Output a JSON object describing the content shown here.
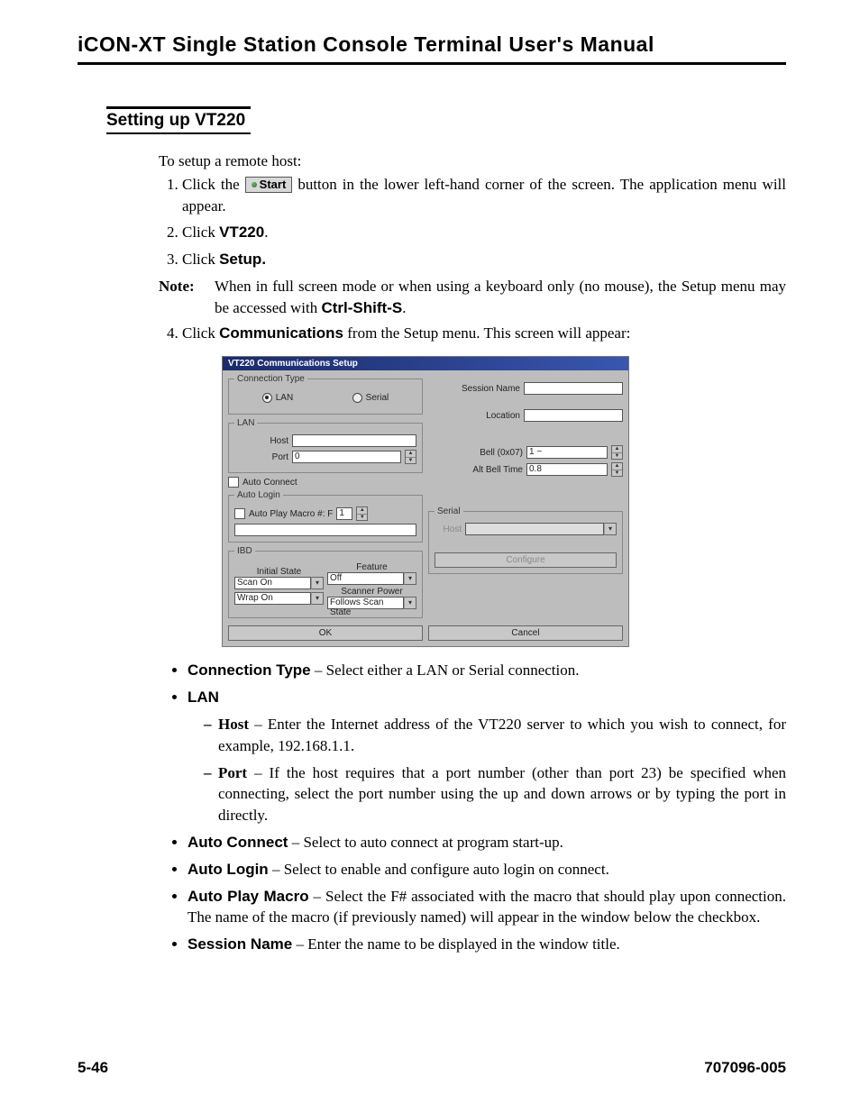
{
  "header": {
    "title": "iCON-XT Single Station Console Terminal User's Manual"
  },
  "section": {
    "title": "Setting up VT220"
  },
  "intro": "To setup a remote host:",
  "steps": {
    "s1a": "Click the",
    "s1_start": "Start",
    "s1b": " button in the lower left-hand corner of the screen. The application menu will appear.",
    "s2a": "Click ",
    "s2b": "VT220",
    "s2c": ".",
    "s3a": "Click ",
    "s3b": "Setup.",
    "s4a": "Click ",
    "s4b": "Communications",
    "s4c": " from the Setup menu. This screen will appear:"
  },
  "note": {
    "label": "Note:",
    "body_a": "When in full screen mode or when using a keyboard only (no mouse), the Setup menu may be accessed with ",
    "shortcut": "Ctrl-Shift-S",
    "body_b": "."
  },
  "dialog": {
    "title": "VT220 Communications Setup",
    "conn_type_legend": "Connection Type",
    "radio_lan": "LAN",
    "radio_serial": "Serial",
    "lan_legend": "LAN",
    "host_label": "Host",
    "port_label": "Port",
    "port_value": "0",
    "auto_connect": "Auto Connect",
    "auto_login_legend": "Auto Login",
    "auto_play_macro": "Auto Play Macro #: F",
    "auto_play_value": "1",
    "ibd_legend": "IBD",
    "initial_state": "Initial State",
    "initial_state_value": "Scan On",
    "feature": "Feature",
    "feature_value": "Off",
    "wrap_value": "Wrap On",
    "scanner_power": "Scanner Power",
    "scanner_power_value": "Follows Scan State",
    "session_name": "Session Name",
    "location": "Location",
    "bell": "Bell (0x07)",
    "bell_value": "1 ~",
    "alt_bell": "Alt Bell Time",
    "alt_bell_value": "0.8",
    "serial_legend": "Serial",
    "serial_host": "Host",
    "configure": "Configure",
    "ok": "OK",
    "cancel": "Cancel"
  },
  "desc": {
    "conn_type_t": "Connection Type",
    "conn_type_b": " – Select either a LAN or Serial connection.",
    "lan_t": "LAN",
    "lan_host_t": "Host",
    "lan_host_b": " – Enter the Internet address of the VT220 server to which you wish to connect, for example, 192.168.1.1.",
    "lan_port_t": "Port",
    "lan_port_b": " – If the host requires that a port number (other than port 23) be specified when connecting, select the port number using the up and down arrows or by typing the port in directly.",
    "auto_connect_t": "Auto Connect",
    "auto_connect_b": " – Select to auto connect at program start-up.",
    "auto_login_t": "Auto Login",
    "auto_login_b": " – Select to enable and configure auto login on connect.",
    "auto_play_t": "Auto Play Macro",
    "auto_play_b": " – Select the F# associated with the macro that should play upon connection. The name of the macro (if previously named) will appear in the window below the checkbox.",
    "session_t": "Session Name",
    "session_b": " – Enter the name to be displayed in the window title."
  },
  "footer": {
    "page": "5-46",
    "docnum": "707096-005"
  }
}
